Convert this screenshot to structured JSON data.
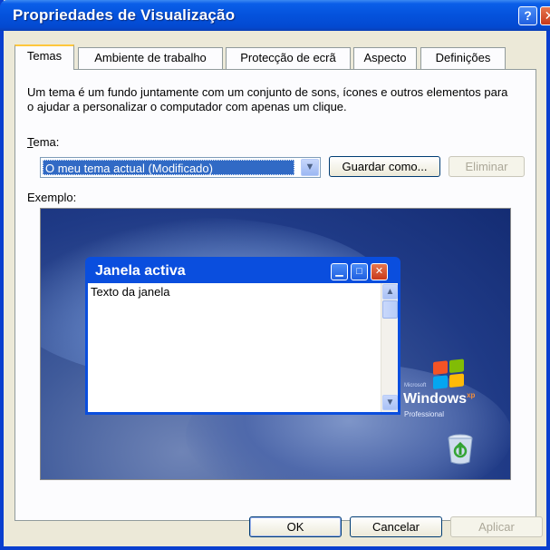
{
  "window": {
    "title": "Propriedades de Visualização",
    "help_label": "?",
    "close_label": "✕"
  },
  "tabs": [
    {
      "label": "Temas",
      "active": true
    },
    {
      "label": "Ambiente de trabalho",
      "active": false
    },
    {
      "label": "Protecção de ecrã",
      "active": false
    },
    {
      "label": "Aspecto",
      "active": false
    },
    {
      "label": "Definições",
      "active": false
    }
  ],
  "temas": {
    "description": "Um tema é um fundo juntamente com um conjunto de sons, ícones e outros elementos para o ajudar a personalizar o computador com apenas um clique.",
    "tema_label": "Tema:",
    "selected_theme": "O meu tema actual (Modificado)",
    "save_as_label": "Guardar como...",
    "delete_label": "Eliminar",
    "example_label": "Exemplo:"
  },
  "preview": {
    "window_title": "Janela activa",
    "window_text": "Texto da janela",
    "logo_word": "Windows",
    "logo_sup": "xp",
    "logo_edition": "Professional",
    "logo_ms": "Microsoft"
  },
  "footer": {
    "ok_label": "OK",
    "cancel_label": "Cancelar",
    "apply_label": "Aplicar"
  },
  "colors": {
    "titlebar": "#0452dc",
    "selection": "#316ac5",
    "dialog_bg": "#ece9d8",
    "tab_highlight": "#ffc73c"
  }
}
